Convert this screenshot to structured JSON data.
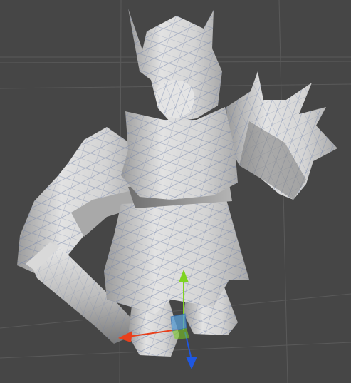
{
  "scene": {
    "background": "#464646",
    "grid_color": "#5a5a5a",
    "model": {
      "name": "knight",
      "shade_base": "#d8d8d8",
      "shade_light": "#f0f0f0",
      "shade_dark": "#8a8a8a",
      "wire_color": "#6d7fa8"
    },
    "gizmo": {
      "x_axis_color": "#e8401c",
      "y_axis_color": "#7ed321",
      "z_axis_color": "#1f57e0",
      "center_color": "#5aa0d8"
    }
  }
}
